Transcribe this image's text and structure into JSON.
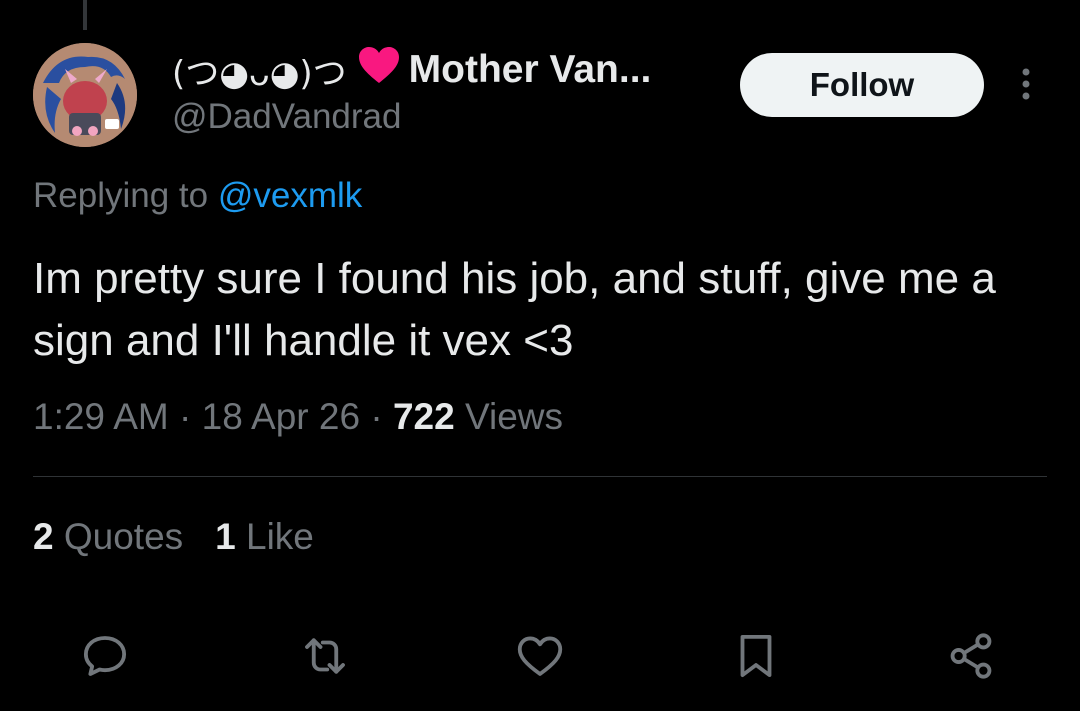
{
  "author": {
    "kaomoji": "(つ◕ᴗ◕)つ",
    "display_name": "Mother Van...",
    "handle": "@DadVandrad"
  },
  "follow_label": "Follow",
  "reply": {
    "prefix": "Replying to ",
    "mention": "@vexmlk"
  },
  "tweet": {
    "text": "Im pretty sure I found his job, and stuff, give me a sign and I'll handle it vex <3"
  },
  "meta": {
    "time": "1:29 AM",
    "sep": " · ",
    "date": "18 Apr 26",
    "views_count": "722",
    "views_label": " Views"
  },
  "stats": {
    "quotes_count": "2",
    "quotes_label": " Quotes",
    "likes_count": "1",
    "likes_label": " Like"
  },
  "icons": [
    "reply-icon",
    "retweet-icon",
    "like-icon",
    "bookmark-icon",
    "share-icon",
    "more-icon",
    "heart-emoji-icon"
  ],
  "colors": {
    "background": "#000000",
    "text": "#e7e9ea",
    "muted": "#71767b",
    "link": "#1d9bf0",
    "heart": "#f91880"
  }
}
